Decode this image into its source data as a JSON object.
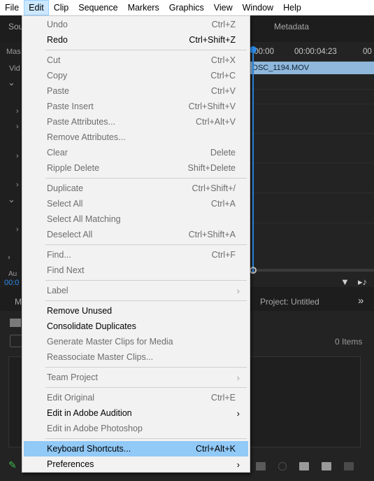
{
  "menubar": {
    "items": [
      "File",
      "Edit",
      "Clip",
      "Sequence",
      "Markers",
      "Graphics",
      "View",
      "Window",
      "Help"
    ],
    "active": "Edit"
  },
  "background": {
    "source_tab": "Sou",
    "metadata_tab": "Metadata",
    "master_tab": "Mas",
    "video_label": "Vid",
    "timecode_start": ":00:00",
    "timecode_mid": "00:00:04:23",
    "timecode_end": "00",
    "clip_name": "DSC_1194.MOV",
    "timecode_blue": "00:0",
    "audio_label": "Au",
    "project_tab_left": "M",
    "project_title": "Project: Untitled",
    "items_count": "0 Items"
  },
  "edit_menu": {
    "rows": [
      {
        "label": "Undo",
        "shortcut": "Ctrl+Z",
        "enabled": false
      },
      {
        "label": "Redo",
        "shortcut": "Ctrl+Shift+Z",
        "enabled": true
      },
      {
        "label": "Cut",
        "shortcut": "Ctrl+X",
        "enabled": false
      },
      {
        "label": "Copy",
        "shortcut": "Ctrl+C",
        "enabled": false
      },
      {
        "label": "Paste",
        "shortcut": "Ctrl+V",
        "enabled": false
      },
      {
        "label": "Paste Insert",
        "shortcut": "Ctrl+Shift+V",
        "enabled": false
      },
      {
        "label": "Paste Attributes...",
        "shortcut": "Ctrl+Alt+V",
        "enabled": false
      },
      {
        "label": "Remove Attributes...",
        "shortcut": "",
        "enabled": false
      },
      {
        "label": "Clear",
        "shortcut": "Delete",
        "enabled": false
      },
      {
        "label": "Ripple Delete",
        "shortcut": "Shift+Delete",
        "enabled": false
      },
      {
        "label": "Duplicate",
        "shortcut": "Ctrl+Shift+/",
        "enabled": false
      },
      {
        "label": "Select All",
        "shortcut": "Ctrl+A",
        "enabled": false
      },
      {
        "label": "Select All Matching",
        "shortcut": "",
        "enabled": false
      },
      {
        "label": "Deselect All",
        "shortcut": "Ctrl+Shift+A",
        "enabled": false
      },
      {
        "label": "Find...",
        "shortcut": "Ctrl+F",
        "enabled": false
      },
      {
        "label": "Find Next",
        "shortcut": "",
        "enabled": false
      },
      {
        "label": "Label",
        "shortcut": "",
        "enabled": false,
        "submenu": true
      },
      {
        "label": "Remove Unused",
        "shortcut": "",
        "enabled": true
      },
      {
        "label": "Consolidate Duplicates",
        "shortcut": "",
        "enabled": true
      },
      {
        "label": "Generate Master Clips for Media",
        "shortcut": "",
        "enabled": false
      },
      {
        "label": "Reassociate Master Clips...",
        "shortcut": "",
        "enabled": false
      },
      {
        "label": "Team Project",
        "shortcut": "",
        "enabled": false,
        "submenu": true
      },
      {
        "label": "Edit Original",
        "shortcut": "Ctrl+E",
        "enabled": false
      },
      {
        "label": "Edit in Adobe Audition",
        "shortcut": "",
        "enabled": true,
        "submenu": true
      },
      {
        "label": "Edit in Adobe Photoshop",
        "shortcut": "",
        "enabled": false
      },
      {
        "label": "Keyboard Shortcuts...",
        "shortcut": "Ctrl+Alt+K",
        "enabled": true,
        "highlighted": true
      },
      {
        "label": "Preferences",
        "shortcut": "",
        "enabled": true,
        "submenu": true
      }
    ],
    "submenu_arrow": "›"
  }
}
